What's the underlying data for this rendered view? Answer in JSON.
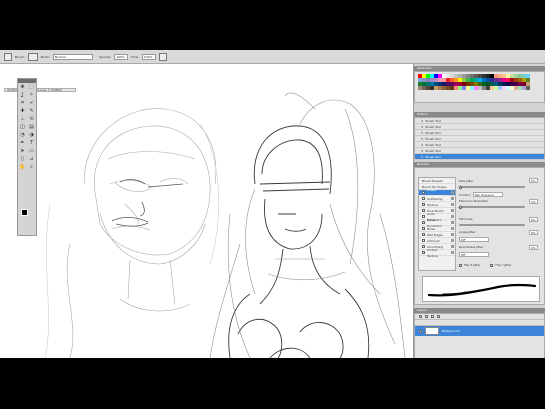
{
  "options_bar": {
    "brush_label": "Brush:",
    "mode_label": "Mode:",
    "mode_value": "Normal",
    "opacity_label": "Opacity:",
    "opacity_value": "100%",
    "flow_label": "Flow:",
    "flow_value": "100%"
  },
  "document_tab": "Untitled-1 @ 66.7% (Layer 1, RGB/8)",
  "toolbox": {
    "tools": [
      "move-icon",
      "marquee-icon",
      "lasso-icon",
      "magic-wand-icon",
      "crop-icon",
      "slice-icon",
      "healing-icon",
      "brush-icon",
      "stamp-icon",
      "history-brush-icon",
      "eraser-icon",
      "gradient-icon",
      "blur-icon",
      "dodge-icon",
      "pen-icon",
      "type-icon",
      "path-select-icon",
      "shape-icon",
      "notes-icon",
      "eyedropper-icon",
      "hand-icon",
      "zoom-icon"
    ],
    "glyphs": [
      "✥",
      "⬚",
      "ʆ",
      "✧",
      "⌗",
      "⌿",
      "✚",
      "✎",
      "⊥",
      "⟲",
      "◫",
      "▤",
      "◔",
      "◑",
      "✒",
      "T",
      "➤",
      "▭",
      "▯",
      "⊿",
      "✋",
      "⌕"
    ]
  },
  "swatches_tab": "Swatches",
  "swatch_colors": [
    "#ff0000",
    "#ffff00",
    "#00ff00",
    "#00ffff",
    "#0000ff",
    "#ff00ff",
    "#ffffff",
    "#ebebeb",
    "#d6d6d6",
    "#c2c2c2",
    "#adadad",
    "#999999",
    "#858585",
    "#707070",
    "#5c5c5c",
    "#474747",
    "#333333",
    "#1f1f1f",
    "#000000",
    "#f7977a",
    "#f9ad81",
    "#fdc68a",
    "#fff79a",
    "#c4df9b",
    "#a2d39c",
    "#82ca9d",
    "#7bcdc8",
    "#6ecff6",
    "#7ea7d8",
    "#8493ca",
    "#8882be",
    "#a187be",
    "#bc8dbf",
    "#f49ac2",
    "#f6989d",
    "#ed1c24",
    "#f26522",
    "#f7941d",
    "#fff200",
    "#8dc73f",
    "#39b54a",
    "#00a651",
    "#00a99d",
    "#00aeef",
    "#0072bc",
    "#0054a6",
    "#2e3192",
    "#662d91",
    "#92278f",
    "#ec008c",
    "#ed145b",
    "#9e0b0f",
    "#a0410d",
    "#a36209",
    "#aba000",
    "#598527",
    "#1a7b30",
    "#007236",
    "#00746b",
    "#0076a3",
    "#004b80",
    "#003471",
    "#1b1464",
    "#440e62",
    "#630460",
    "#9e005d",
    "#9e0039",
    "#790000",
    "#7b2e00",
    "#7d4900",
    "#827b00",
    "#406618",
    "#005e20",
    "#005826",
    "#005952",
    "#005b7f",
    "#003663",
    "#002157",
    "#0d004c",
    "#32004b",
    "#4b0049",
    "#7b0046",
    "#7a0026",
    "#c69c6d",
    "#998675",
    "#736357",
    "#534741",
    "#37302d",
    "#c69c6d",
    "#a67c52",
    "#8c6239",
    "#754c24",
    "#603913",
    "#ff8080",
    "#80ff80",
    "#8080ff",
    "#ffff80",
    "#80ffff",
    "#ff80ff",
    "#c0c0c0",
    "#808080",
    "#404040",
    "#ffcc99",
    "#ccff99",
    "#99ccff",
    "#ffccff",
    "#ccffff",
    "#ffffcc",
    "#e0b0a0",
    "#a0e0b0",
    "#b0a0e0",
    "#606060"
  ],
  "history_tab": "History",
  "history_items": [
    "Brush Tool",
    "Brush Tool",
    "Brush Tool",
    "Brush Tool",
    "Brush Tool",
    "Brush Tool",
    "Brush Tool"
  ],
  "brushes_tab": "Brushes",
  "brush_left": [
    "Brush Presets",
    "Brush Tip Shape",
    "Shape Dynamics",
    "Scattering",
    "Texture",
    "Dual Brush",
    "Color Dynamics",
    "Other Dynamics",
    "Noise",
    "Wet Edges",
    "Airbrush",
    "Smoothing",
    "Protect Texture"
  ],
  "brush_right": {
    "jitter_label": "Size Jitter",
    "jitter_value": "0%",
    "control_label": "Control:",
    "control_value": "Pen Pressure",
    "min_diameter_label": "Minimum Diameter",
    "min_diameter_value": "0%",
    "tilt_label": "Tilt Scale",
    "tilt_value": "0%",
    "angle_jitter_label": "Angle Jitter",
    "angle_jitter_value": "0%",
    "control2_value": "Off",
    "roundness_label": "Roundness Jitter",
    "roundness_value": "0%",
    "control3_value": "Off",
    "flip_x": "Flip X Jitter",
    "flip_y": "Flip Y Jitter"
  },
  "layers_tab": "Layers",
  "layers": [
    "Background"
  ]
}
